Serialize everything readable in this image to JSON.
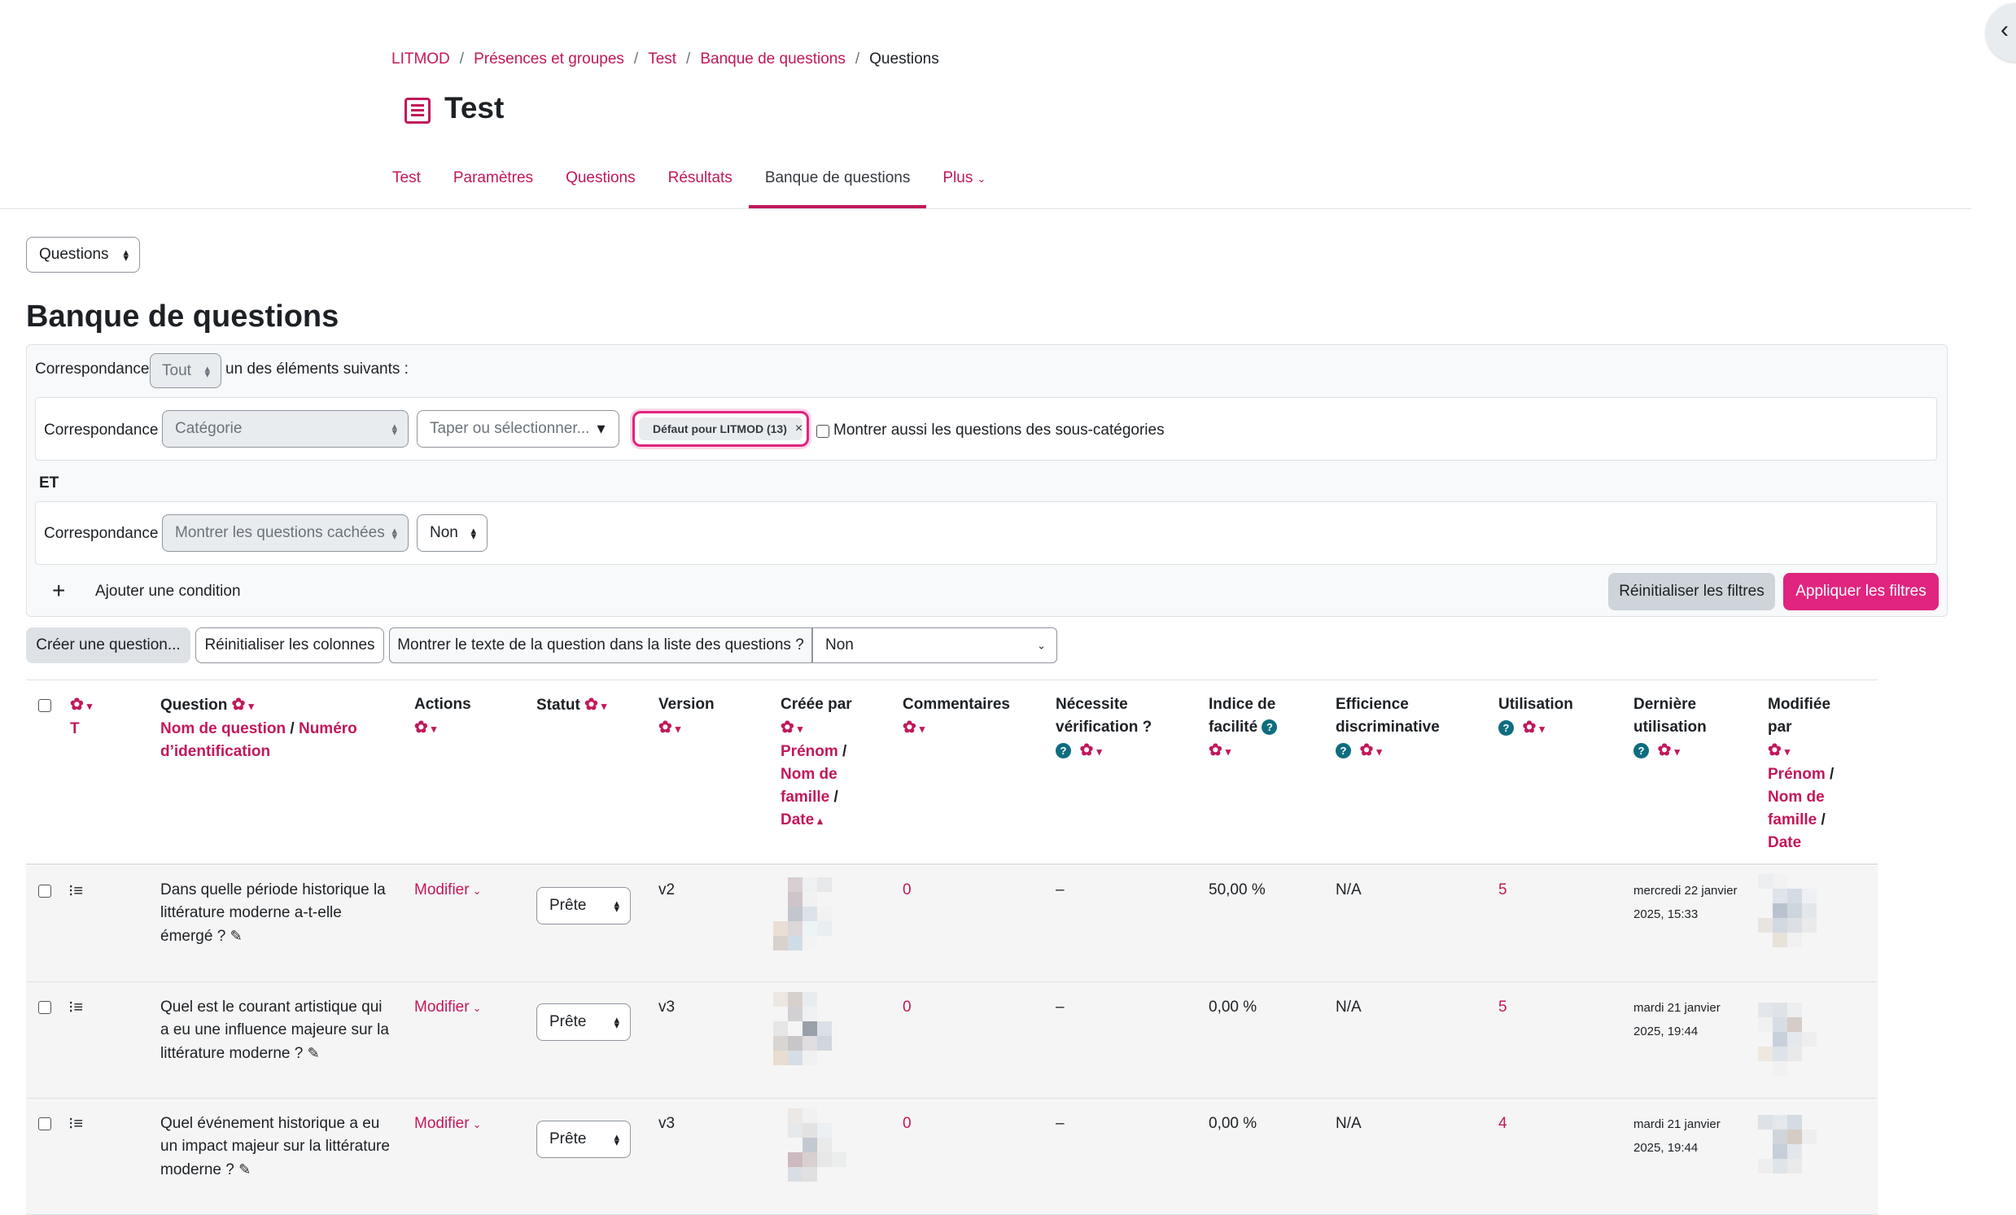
{
  "breadcrumb": [
    "LITMOD",
    "Présences et groupes",
    "Test",
    "Banque de questions"
  ],
  "breadcrumb_current": "Questions",
  "page_title": "Test",
  "tabs": [
    "Test",
    "Paramètres",
    "Questions",
    "Résultats",
    "Banque de questions",
    "Plus"
  ],
  "active_tab": "Banque de questions",
  "view_select": "Questions",
  "heading": "Banque de questions",
  "filter": {
    "match_label": "Correspondance",
    "match_all": "Tout",
    "match_suffix": "un des éléments suivants :",
    "row1": {
      "label": "Correspondance",
      "field": "Catégorie",
      "search_placeholder": "Taper ou sélectionner...",
      "chip": "Défaut pour LITMOD (13)",
      "chip_remove": "×",
      "subcats_label": "Montrer aussi les questions des sous-catégories"
    },
    "joiner": "ET",
    "row2": {
      "label": "Correspondance",
      "field": "Montrer les questions cachées",
      "value": "Non"
    },
    "add_condition": "Ajouter une condition",
    "reset": "Réinitialiser les filtres",
    "apply": "Appliquer les filtres"
  },
  "toolbar": {
    "create": "Créer une question...",
    "reset_columns": "Réinitialiser les colonnes",
    "show_text_label": "Montrer le texte de la question dans la liste des questions ?",
    "show_text_value": "Non"
  },
  "columns": {
    "t": "T",
    "question": "Question",
    "question_sort1": "Nom de question",
    "question_sort2": "Numéro d’identification",
    "actions": "Actions",
    "status": "Statut",
    "version": "Version",
    "created_by": "Créée par",
    "created_sort1": "Prénom",
    "created_sort2": "Nom de famille",
    "created_sort3": "Date",
    "comments": "Commentaires",
    "needs_check": "Nécessite vérification ?",
    "facility": "Indice de facilité",
    "discrimination": "Efficience discriminative",
    "usage": "Utilisation",
    "last_used": "Dernière utilisation",
    "modified_by": "Modifiée par",
    "modified_sort1": "Prénom",
    "modified_sort2": "Nom de famille",
    "modified_sort3": "Date"
  },
  "rows": [
    {
      "text": "Dans quelle période historique la littérature moderne a-t-elle émergé ?",
      "action": "Modifier",
      "status": "Prête",
      "version": "v2",
      "comments": "0",
      "needs_check": "–",
      "facility": "50,00 %",
      "discrimination": "N/A",
      "usage": "5",
      "last_used": "mercredi 22 janvier 2025, 15:33"
    },
    {
      "text": "Quel est le courant artistique qui a eu une influence majeure sur la littérature moderne ?",
      "action": "Modifier",
      "status": "Prête",
      "version": "v3",
      "comments": "0",
      "needs_check": "–",
      "facility": "0,00 %",
      "discrimination": "N/A",
      "usage": "5",
      "last_used": "mardi 21 janvier 2025, 19:44"
    },
    {
      "text": "Quel événement historique a eu un impact majeur sur la littérature moderne ?",
      "action": "Modifier",
      "status": "Prête",
      "version": "v3",
      "comments": "0",
      "needs_check": "–",
      "facility": "0,00 %",
      "discrimination": "N/A",
      "usage": "4",
      "last_used": "mardi 21 janvier 2025, 19:44"
    }
  ],
  "colors": {
    "accent": "#c2185b",
    "primary_button": "#e0247f",
    "help": "#0f6d80"
  }
}
